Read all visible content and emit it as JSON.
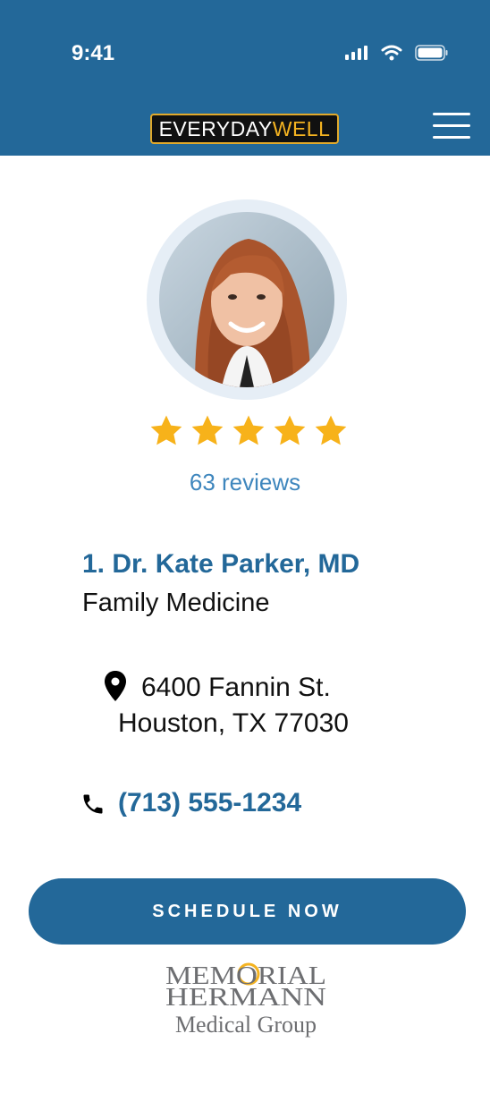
{
  "status_bar": {
    "time": "9:41",
    "icons": [
      "signal-icon",
      "wifi-icon",
      "battery-icon"
    ]
  },
  "header": {
    "logo_part1": "EVERYDAY",
    "logo_part2": "WELL",
    "menu_icon": "hamburger-menu-icon",
    "colors": {
      "background": "#236899",
      "logo_accent": "#f4b321"
    }
  },
  "doctor": {
    "rating_stars": 5,
    "reviews": "63 reviews",
    "name": "1. Dr. Kate Parker, MD",
    "specialty": "Family Medicine",
    "address_line1": "6400 Fannin St.",
    "address_line2": "Houston, TX 77030",
    "phone": "(713) 555-1234"
  },
  "actions": {
    "schedule_label": "SCHEDULE NOW"
  },
  "affiliation": {
    "line1": "MEMORIAL",
    "line2": "HERMANN",
    "line3": "Medical Group"
  },
  "colors": {
    "primary": "#236899",
    "link": "#3e86bd",
    "star": "#f7b21a"
  }
}
